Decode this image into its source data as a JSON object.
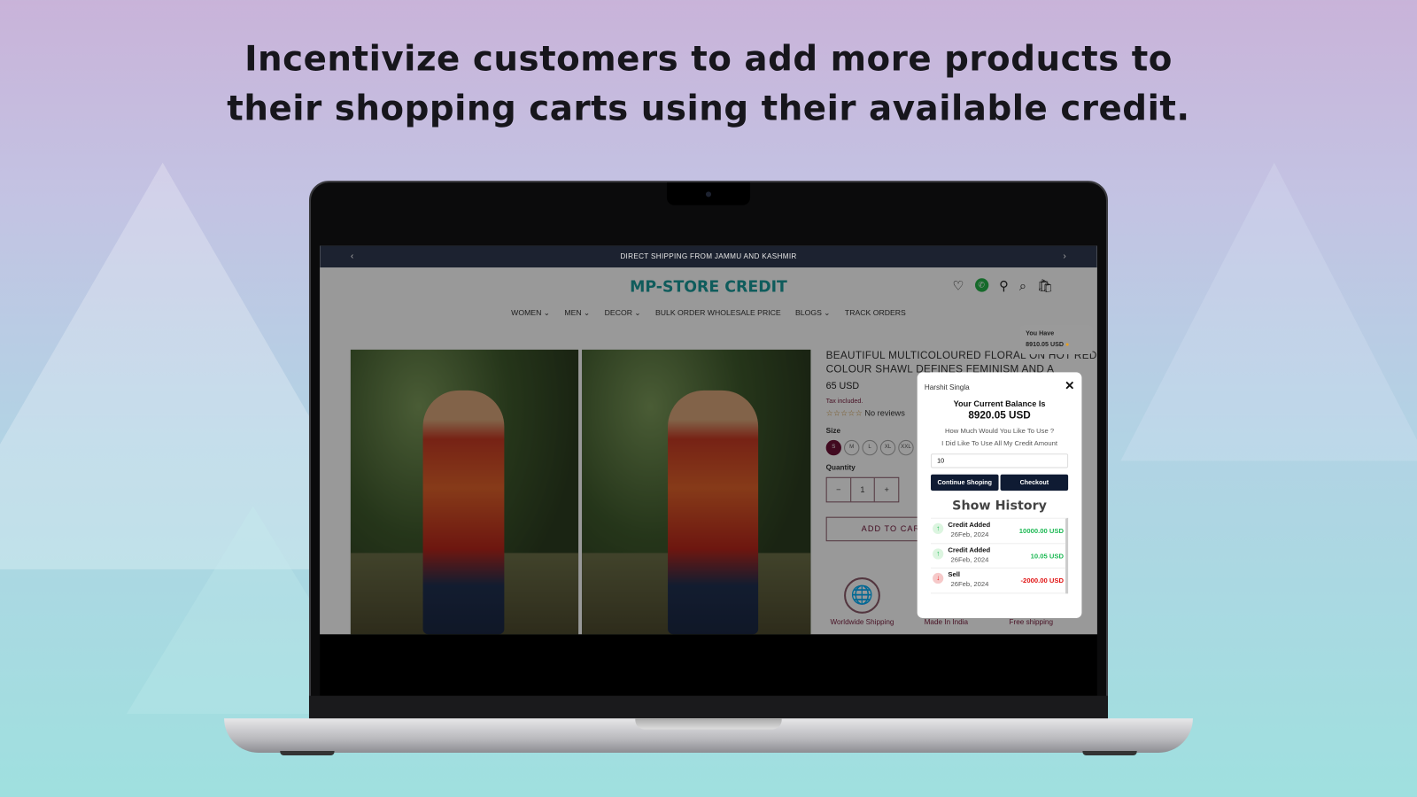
{
  "headline": {
    "line1": "Incentivize customers to add more products to",
    "line2": "their shopping carts using their available credit."
  },
  "store": {
    "announcement": "DIRECT SHIPPING FROM JAMMU AND KASHMIR",
    "logo": "MP-STORE CREDIT",
    "nav": [
      "WOMEN ⌄",
      "MEN ⌄",
      "DECOR ⌄",
      "BULK ORDER WHOLESALE PRICE",
      "BLOGS ⌄",
      "TRACK ORDERS"
    ],
    "header_icons": [
      "heart-icon",
      "whatsapp-icon",
      "user-icon",
      "search-icon",
      "cart-icon"
    ],
    "product": {
      "title": "BEAUTIFUL MULTICOLOURED FLORAL ON HOT RED COLOUR SHAWL DEFINES FEMINISM AND A",
      "price": "65 USD",
      "tax": "Tax included.",
      "reviews": "No reviews",
      "size_label": "Size",
      "sizes": [
        "S",
        "M",
        "L",
        "XL",
        "XXL"
      ],
      "selected_size": "S",
      "quantity_label": "Quantity",
      "quantity": "1",
      "minus": "−",
      "plus": "+",
      "add_to_cart": "ADD TO CART",
      "features": [
        "Worldwide Shipping",
        "Made In India",
        "Free shipping"
      ]
    },
    "you_have": {
      "label": "You Have",
      "amount": "8910.05 USD"
    },
    "popup": {
      "user": "Harshit Singla",
      "close": "✕",
      "heading": "Your Current Balance Is",
      "balance": "8920.05 USD",
      "question": "How Much Would You Like To Use ?",
      "use_all": "I Did Like To Use All My Credit Amount",
      "amount_value": "10",
      "continue": "Continue Shoping",
      "checkout": "Checkout",
      "history_title": "Show History",
      "history": [
        {
          "type": "Credit Added",
          "date": "26Feb, 2024",
          "amount": "10000.00 USD",
          "direction": "up"
        },
        {
          "type": "Credit Added",
          "date": "26Feb, 2024",
          "amount": "10.05 USD",
          "direction": "up"
        },
        {
          "type": "Sell",
          "date": "26Feb, 2024",
          "amount": "-2000.00 USD",
          "direction": "down"
        }
      ]
    }
  },
  "colors": {
    "brand": "#1a9a9a",
    "button": "#0f1b33",
    "credit": "#1db954",
    "debit": "#e11111",
    "size_selected": "#6d1236"
  }
}
